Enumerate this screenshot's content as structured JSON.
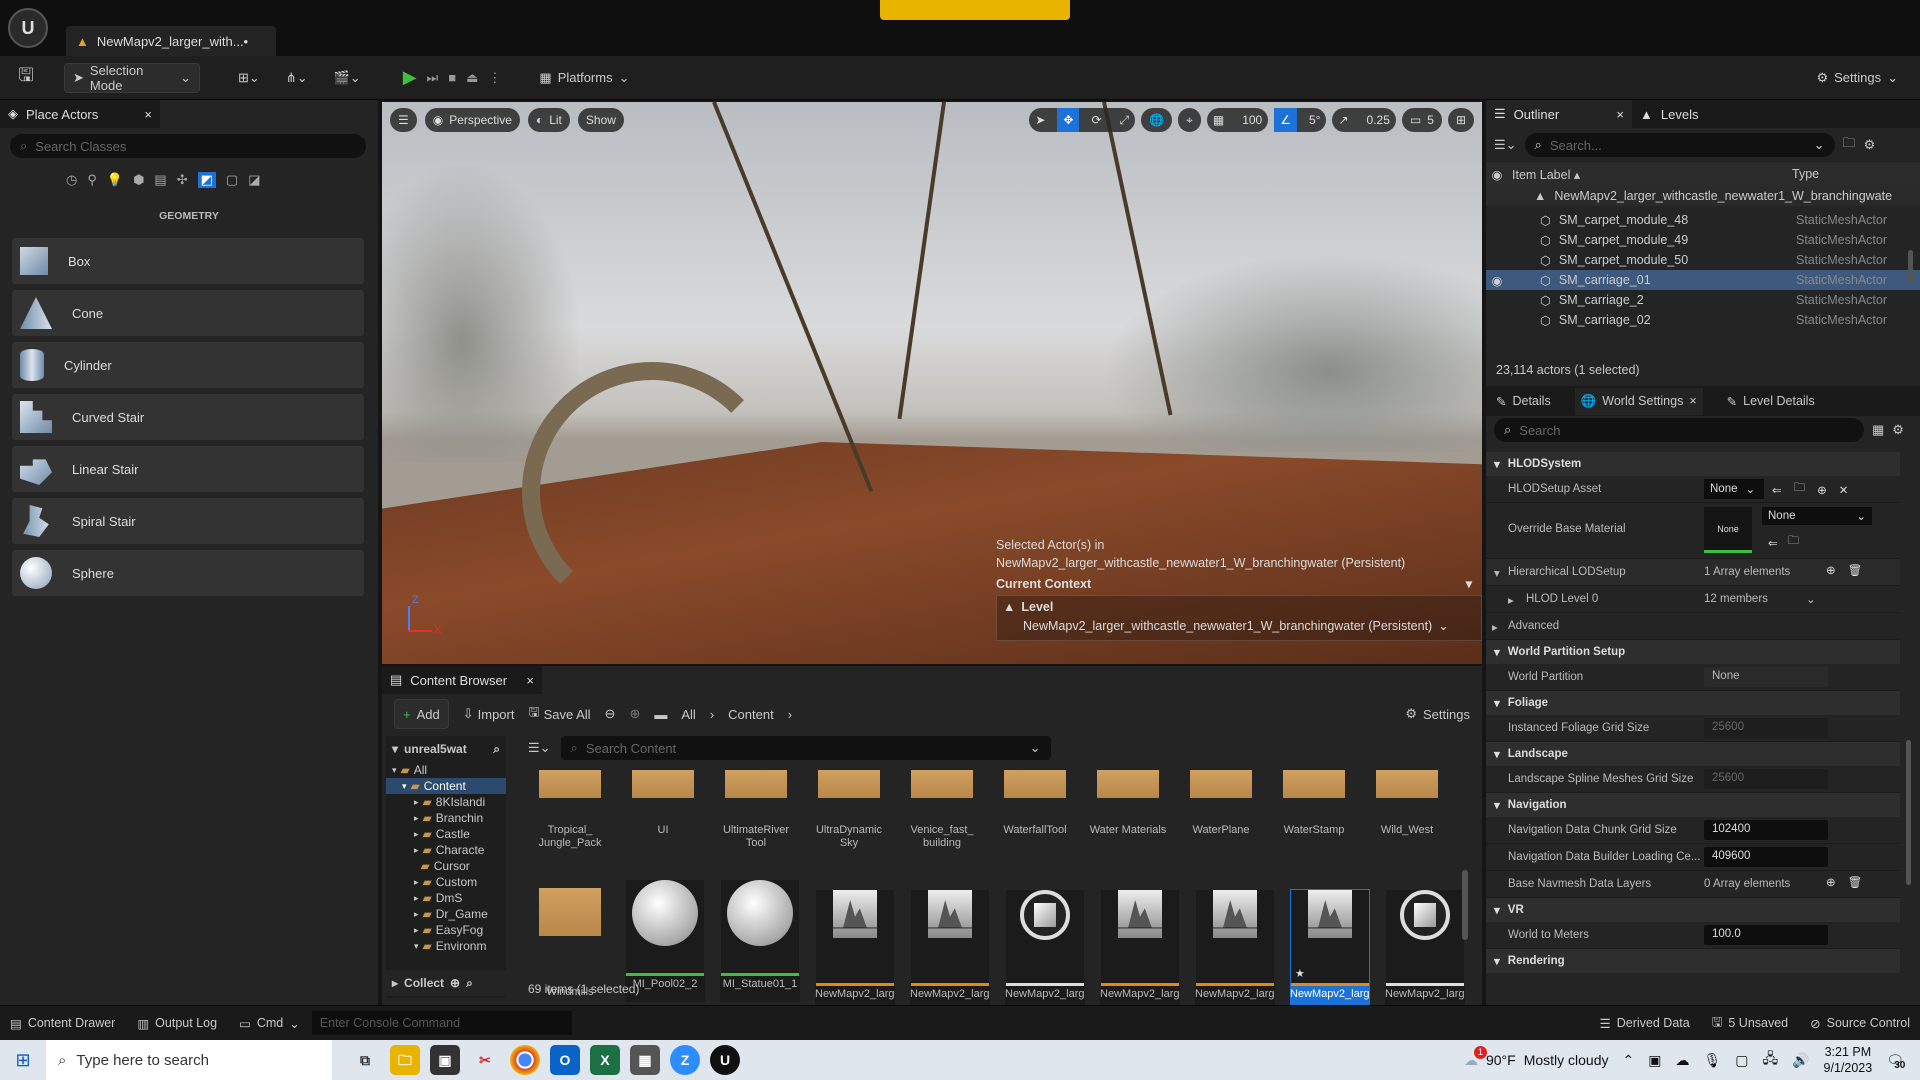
{
  "titlebar": {
    "doc_tab": "NewMapv2_larger_with...•"
  },
  "toolbar": {
    "selection_mode": "Selection Mode",
    "platforms": "Platforms",
    "settings": "Settings"
  },
  "place_actors": {
    "tab": "Place Actors",
    "search_placeholder": "Search Classes",
    "category": "GEOMETRY",
    "items": [
      {
        "label": "Box"
      },
      {
        "label": "Cone"
      },
      {
        "label": "Cylinder"
      },
      {
        "label": "Curved Stair"
      },
      {
        "label": "Linear Stair"
      },
      {
        "label": "Spiral Stair"
      },
      {
        "label": "Sphere"
      }
    ]
  },
  "viewport": {
    "perspective": "Perspective",
    "lit": "Lit",
    "show": "Show",
    "grid": "100",
    "angle": "5°",
    "scale": "0.25",
    "camera_speed": "5",
    "selected_in": "Selected Actor(s) in",
    "selected_level": "NewMapv2_larger_withcastle_newwater1_W_branchingwater (Persistent)",
    "current_context": "Current Context",
    "level_label": "Level",
    "level_value": "NewMapv2_larger_withcastle_newwater1_W_branchingwater (Persistent)",
    "axis_z": "Z",
    "axis_x": "X"
  },
  "content_browser": {
    "tab": "Content Browser",
    "add": "Add",
    "import": "Import",
    "save_all": "Save All",
    "crumbs": [
      "All",
      "Content"
    ],
    "settings": "Settings",
    "root": "unreal5wat",
    "search_placeholder": "Search Content",
    "collect": "Collect",
    "count": "69 items (1 selected)",
    "tree": [
      "All",
      "Content",
      "8KIslandi",
      "Branchin",
      "Castle",
      "Characte",
      "Cursor",
      "Custom",
      "DmS",
      "Dr_Game",
      "EasyFog",
      "Environm"
    ],
    "folders": [
      "Tropical_ Jungle_Pack",
      "UI",
      "UltimateRiver Tool",
      "UltraDynamic Sky",
      "Venice_fast_ building",
      "WaterfallTool",
      "Water Materials",
      "WaterPlane",
      "WaterStamp",
      "Wild_West"
    ],
    "assets": [
      {
        "label": "Windmills",
        "kind": "folder"
      },
      {
        "label": "MI_Pool02_2",
        "kind": "sphere",
        "bar": "#3fbf3f"
      },
      {
        "label": "MI_Statue01_1",
        "kind": "sphere",
        "bar": "#3fbf3f"
      },
      {
        "label": "NewMapv2_larger",
        "kind": "map",
        "bar": "#e08a1e"
      },
      {
        "label": "NewMapv2_larger",
        "kind": "map",
        "bar": "#e08a1e"
      },
      {
        "label": "NewMapv2_larger",
        "kind": "cube",
        "bar": "#dddddd"
      },
      {
        "label": "NewMapv2_larger",
        "kind": "map",
        "bar": "#e08a1e"
      },
      {
        "label": "NewMapv2_larger",
        "kind": "map",
        "bar": "#e08a1e"
      },
      {
        "label": "NewMapv2_larger",
        "kind": "map",
        "bar": "#e08a1e",
        "selected": true
      },
      {
        "label": "NewMapv2_larger",
        "kind": "cube",
        "bar": "#dddddd"
      }
    ]
  },
  "outliner": {
    "tab": "Outliner",
    "levels_tab": "Levels",
    "search_placeholder": "Search...",
    "col_label": "Item Label",
    "col_type": "Type",
    "root": "NewMapv2_larger_withcastle_newwater1_W_branchingwate",
    "rows": [
      {
        "label": "SM_carpet_module_48",
        "type": "StaticMeshActor"
      },
      {
        "label": "SM_carpet_module_49",
        "type": "StaticMeshActor"
      },
      {
        "label": "SM_carpet_module_50",
        "type": "StaticMeshActor"
      },
      {
        "label": "SM_carriage_01",
        "type": "StaticMeshActor",
        "selected": true
      },
      {
        "label": "SM_carriage_2",
        "type": "StaticMeshActor"
      },
      {
        "label": "SM_carriage_02",
        "type": "StaticMeshActor"
      }
    ],
    "count": "23,114 actors (1 selected)"
  },
  "details": {
    "tabs": [
      "Details",
      "World Settings",
      "Level Details"
    ],
    "search_placeholder": "Search",
    "hlod_system": "HLODSystem",
    "hlod_asset": "HLODSetup Asset",
    "none": "None",
    "override_mat": "Override Base Material",
    "hier_lod": "Hierarchical LODSetup",
    "array1": "1 Array elements",
    "hlod_level": "HLOD Level 0",
    "members": "12 members",
    "advanced": "Advanced",
    "wp_setup": "World Partition Setup",
    "wp": "World Partition",
    "foliage": "Foliage",
    "foliage_grid": "Instanced Foliage Grid Size",
    "foliage_val": "25600",
    "landscape": "Landscape",
    "spline_grid": "Landscape Spline Meshes Grid Size",
    "spline_val": "25600",
    "navigation": "Navigation",
    "nav_chunk": "Navigation Data Chunk Grid Size",
    "nav_chunk_val": "102400",
    "nav_builder": "Navigation Data Builder Loading Ce...",
    "nav_builder_val": "409600",
    "navmesh_layers": "Base Navmesh Data Layers",
    "array0": "0 Array elements",
    "vr": "VR",
    "world_to_meters": "World to Meters",
    "wtm_val": "100.0",
    "rendering": "Rendering"
  },
  "statusbar": {
    "content_drawer": "Content Drawer",
    "output_log": "Output Log",
    "cmd": "Cmd",
    "console_placeholder": "Enter Console Command",
    "derived": "Derived Data",
    "unsaved": "5 Unsaved",
    "source": "Source Control"
  },
  "taskbar": {
    "search": "Type here to search",
    "weather_temp": "90°F",
    "weather": "Mostly cloudy",
    "time": "3:21 PM",
    "date": "9/1/2023",
    "notif": "30",
    "weather_badge": "1"
  }
}
